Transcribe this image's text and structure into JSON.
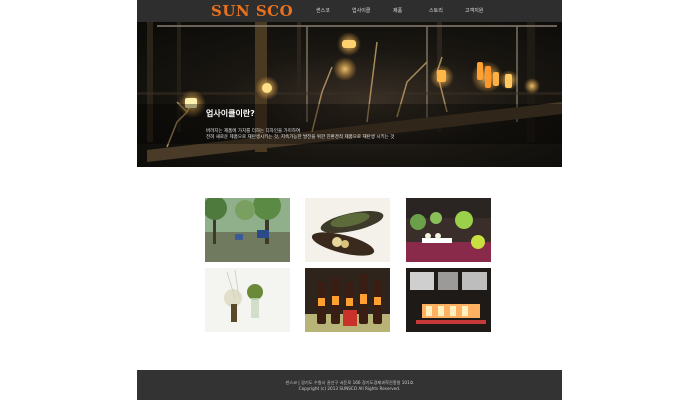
{
  "header": {
    "logo_text": "SUN SCO",
    "nav": [
      "썬스코",
      "업사이클",
      "제품",
      "스토리",
      "고객지원"
    ]
  },
  "hero": {
    "title": "업사이클이란?",
    "body_line1": "버려지는 제품에 가치를 더하는 디자인을 가미하여",
    "body_line2": "전혀 새로운 제품으로 재탄생시키는 것, 지속가능한 발전을 위한 친환경적 제품으로 재탄생 시키는 것"
  },
  "gallery": [
    {
      "name": "park-scene"
    },
    {
      "name": "bottle-plates"
    },
    {
      "name": "table-display"
    },
    {
      "name": "glass-plants"
    },
    {
      "name": "bottle-lamps"
    },
    {
      "name": "lit-display"
    }
  ],
  "footer": {
    "line1": "썬스코 | 경기도 수원시 권선구 서둔로 166 경기도경제과학진흥원 101호",
    "line2": "Copyright (c) 2013 SUNSCO All Rights Reserved."
  },
  "colors": {
    "logo": "#e8721e",
    "header_bg": "#2e2e2e",
    "footer_bg": "#333333"
  }
}
